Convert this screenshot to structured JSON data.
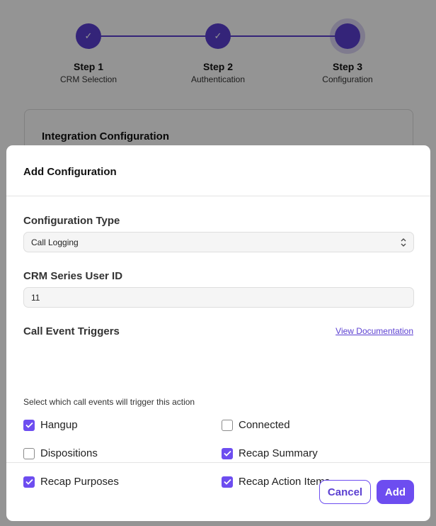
{
  "stepper": {
    "steps": [
      {
        "title": "Step 1",
        "subtitle": "CRM Selection",
        "status": "complete",
        "icon": "check-icon"
      },
      {
        "title": "Step 2",
        "subtitle": "Authentication",
        "status": "complete",
        "icon": "check-icon"
      },
      {
        "title": "Step 3",
        "subtitle": "Configuration",
        "status": "current",
        "icon": ""
      }
    ]
  },
  "background_card": {
    "title": "Integration Configuration"
  },
  "modal": {
    "title": "Add Configuration",
    "configuration_type": {
      "label": "Configuration Type",
      "value": "Call Logging"
    },
    "crm_user_id": {
      "label": "CRM Series User ID",
      "value": "11"
    },
    "triggers": {
      "label": "Call Event Triggers",
      "doc_link": "View Documentation",
      "helper": "Select which call events will trigger this action",
      "items": [
        {
          "label": "Hangup",
          "checked": true
        },
        {
          "label": "Connected",
          "checked": false
        },
        {
          "label": "Dispositions",
          "checked": false
        },
        {
          "label": "Recap Summary",
          "checked": true
        },
        {
          "label": "Recap Purposes",
          "checked": true
        },
        {
          "label": "Recap Action Items",
          "checked": true
        }
      ]
    },
    "buttons": {
      "cancel": "Cancel",
      "add": "Add"
    }
  },
  "colors": {
    "accent": "#6d4df0",
    "accent_dark": "#5b3fd1",
    "overlay": "rgba(0,0,0,0.42)"
  }
}
